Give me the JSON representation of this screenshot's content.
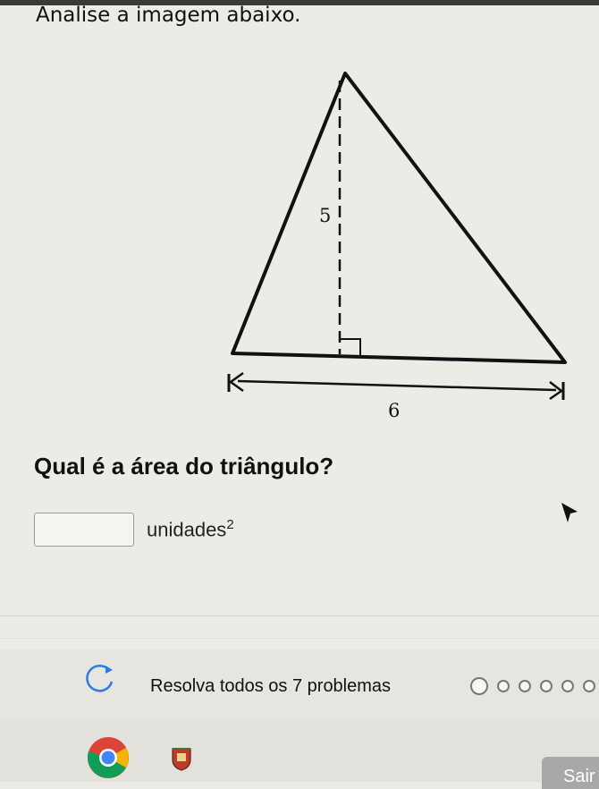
{
  "instruction": "Analise a imagem abaixo.",
  "figure": {
    "height_label": "5",
    "base_label": "6"
  },
  "question": "Qual é a área do triângulo?",
  "answer": {
    "value": "",
    "unit": "unidades",
    "exponent": "2"
  },
  "progress": {
    "text": "Resolva todos os 7 problemas",
    "total": 7,
    "completed": 0
  },
  "footer": {
    "exit_label": "Sair"
  },
  "icons": {
    "reload": "reload-icon",
    "cursor": "mouse-cursor-icon",
    "browser": "chrome-icon",
    "app": "crest-icon"
  }
}
